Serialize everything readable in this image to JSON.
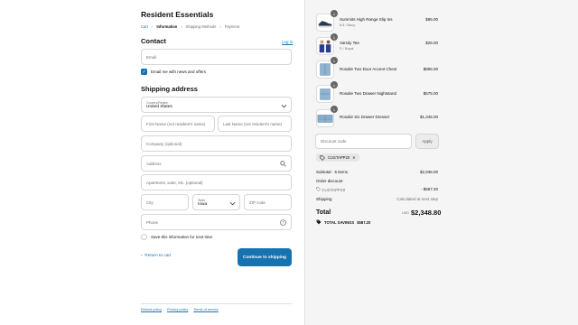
{
  "store": {
    "name": "Resident Essentials"
  },
  "breadcrumbs": {
    "cart": "Cart",
    "information": "Information",
    "shipping": "Shipping Methods",
    "payment": "Payment"
  },
  "contact": {
    "title": "Contact",
    "login_link": "Log in",
    "email_placeholder": "Email",
    "newsletter_label": "Email me with news and offers",
    "newsletter_checked": true
  },
  "shipping": {
    "title": "Shipping address",
    "country_label": "Country/Region",
    "country_value": "United States",
    "first_name_placeholder": "First Name (not resident's name)",
    "last_name_placeholder": "Last Name (not resident's name)",
    "company_placeholder": "Company (optional)",
    "address_placeholder": "Address",
    "apartment_placeholder": "Apartment, suite, etc. (optional)",
    "city_placeholder": "City",
    "state_label": "State",
    "state_value": "Iowa",
    "zip_placeholder": "ZIP code",
    "phone_placeholder": "Phone",
    "save_info_label": "Save this information for next time",
    "save_info_checked": false
  },
  "actions": {
    "return_label": "Return to cart",
    "continue_label": "Continue to shipping"
  },
  "footer": {
    "links": [
      "Refund policy",
      "Privacy policy",
      "Terms of service"
    ]
  },
  "cart": {
    "items": [
      {
        "name": "Summits High Range Slip Ins",
        "variant": "8.5 / Navy",
        "price": "$95.00",
        "qty": "1"
      },
      {
        "name": "Varsity Tee",
        "variant": "S / Royal",
        "price": "$26.00",
        "qty": "1"
      },
      {
        "name": "Rosalie Two Door Accent Chest",
        "variant": "",
        "price": "$895.00",
        "qty": "1"
      },
      {
        "name": "Rosalie Two Drawer Nightstand",
        "variant": "",
        "price": "$575.00",
        "qty": "1"
      },
      {
        "name": "Rosalie Six Drawer Dresser",
        "variant": "",
        "price": "$1,345.00",
        "qty": "1"
      }
    ],
    "discount_placeholder": "Discount code",
    "apply_label": "Apply",
    "applied_code": "CUSTAPP20",
    "subtotal_label": "Subtotal · 5 items",
    "subtotal_value": "$2,936.00",
    "order_discount_label": "Order discount",
    "discount_code_label": "CUSTAPP20",
    "discount_value": "- $587.20",
    "shipping_label": "Shipping",
    "shipping_value": "Calculated at next step",
    "total_label": "Total",
    "currency": "USD",
    "total_value": "$2,348.80",
    "savings_label": "TOTAL SAVINGS",
    "savings_value": "$587.20"
  },
  "colors": {
    "accent": "#1773b0",
    "sidebar_bg": "#f5f5f5"
  }
}
